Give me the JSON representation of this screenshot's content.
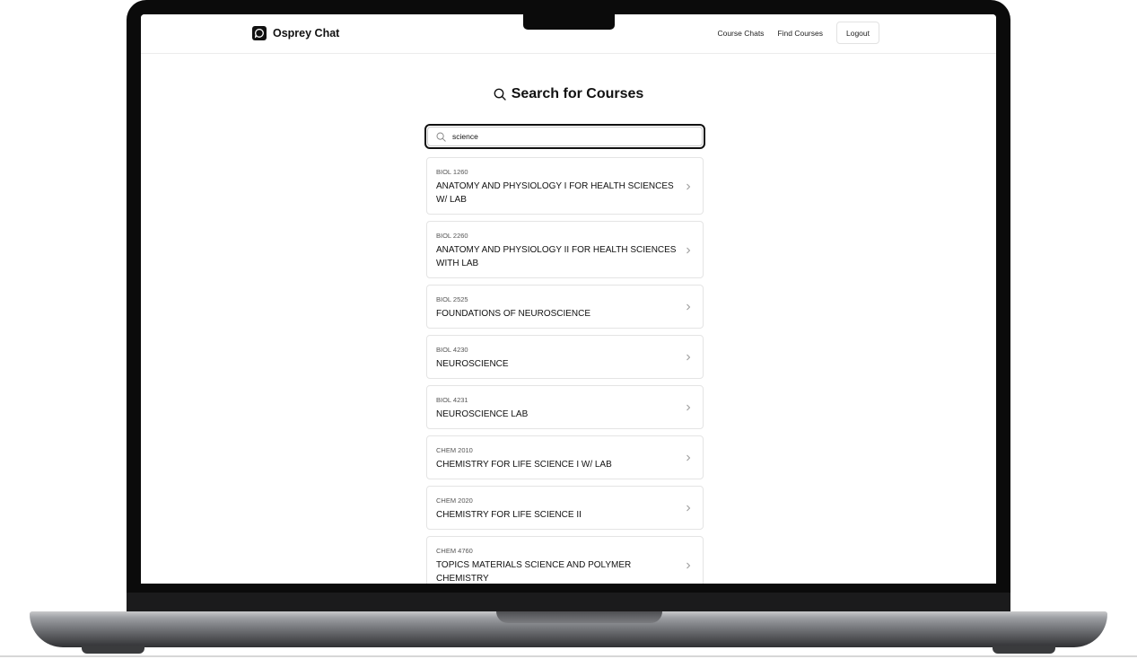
{
  "app": {
    "name": "Osprey Chat"
  },
  "nav": {
    "course_chats": "Course Chats",
    "find_courses": "Find Courses",
    "logout": "Logout"
  },
  "page": {
    "heading": "Search for Courses"
  },
  "search": {
    "value": "science"
  },
  "results": [
    {
      "code": "BIOL 1260",
      "title": "ANATOMY AND PHYSIOLOGY I FOR HEALTH SCIENCES W/ LAB"
    },
    {
      "code": "BIOL 2260",
      "title": "ANATOMY AND PHYSIOLOGY II FOR HEALTH SCIENCES WITH LAB"
    },
    {
      "code": "BIOL 2525",
      "title": "FOUNDATIONS OF NEUROSCIENCE"
    },
    {
      "code": "BIOL 4230",
      "title": "NEUROSCIENCE"
    },
    {
      "code": "BIOL 4231",
      "title": "NEUROSCIENCE LAB"
    },
    {
      "code": "CHEM 2010",
      "title": "CHEMISTRY FOR LIFE SCIENCE I W/ LAB"
    },
    {
      "code": "CHEM 2020",
      "title": "CHEMISTRY FOR LIFE SCIENCE II"
    },
    {
      "code": "CHEM 4760",
      "title": "TOPICS MATERIALS SCIENCE AND POLYMER CHEMISTRY"
    }
  ]
}
